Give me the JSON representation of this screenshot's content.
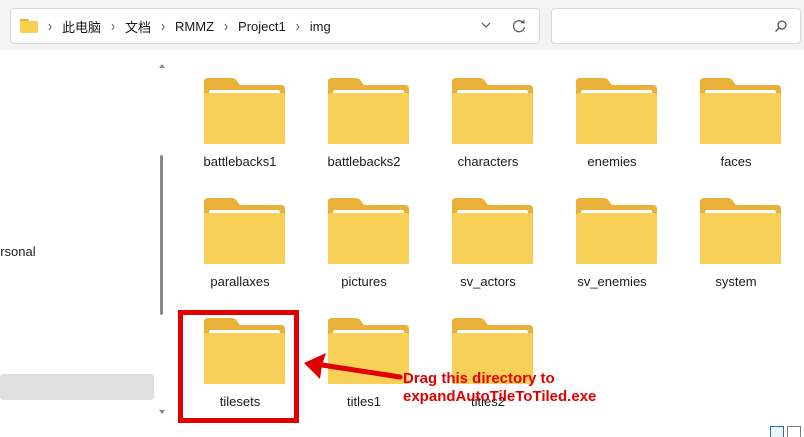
{
  "address_bar": {
    "breadcrumbs": [
      "此电脑",
      "文档",
      "RMMZ",
      "Project1",
      "img"
    ]
  },
  "search": {
    "placeholder": ""
  },
  "nav": {
    "partial_item": "ersonal"
  },
  "folders": [
    {
      "name": "battlebacks1"
    },
    {
      "name": "battlebacks2"
    },
    {
      "name": "characters"
    },
    {
      "name": "enemies"
    },
    {
      "name": "faces"
    },
    {
      "name": "parallaxes"
    },
    {
      "name": "pictures"
    },
    {
      "name": "sv_actors"
    },
    {
      "name": "sv_enemies"
    },
    {
      "name": "system"
    },
    {
      "name": "tilesets"
    },
    {
      "name": "titles1"
    },
    {
      "name": "titles2"
    }
  ],
  "annotation": {
    "line1": "Drag this directory to",
    "line2": "expandAutoTileToTiled.exe",
    "color": "#e00000"
  },
  "colors": {
    "folder_back": "#e9b13a",
    "folder_front": "#f8cf57",
    "folder_paper": "#ffffff"
  },
  "icons": {
    "address": "folder-icon",
    "dropdown": "chevron-down-icon",
    "refresh": "refresh-icon",
    "search": "search-icon"
  }
}
